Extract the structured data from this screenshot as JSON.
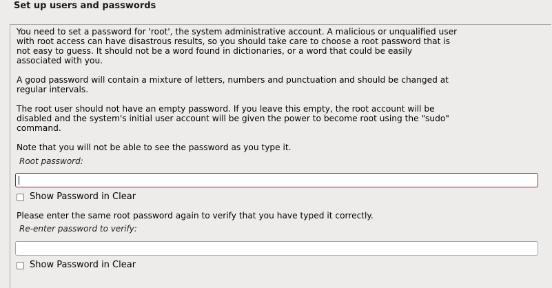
{
  "title": "Set up users and passwords",
  "paragraphs": {
    "intro": "You need to set a password for 'root', the system administrative account. A malicious or unqualified user\nwith root access can have disastrous results, so you should take care to choose a root password that is\nnot easy to guess. It should not be a word found in dictionaries, or a word that could be easily\nassociated with you.",
    "mixture": "A good password will contain a mixture of letters, numbers and punctuation and should be changed at\nregular intervals.",
    "empty": "The root user should not have an empty password. If you leave this empty, the root account will be\ndisabled and the system's initial user account will be given the power to become root using the \"sudo\"\ncommand.",
    "note": "Note that you will not be able to see the password as you type it.",
    "verify": "Please enter the same root password again to verify that you have typed it correctly."
  },
  "root_password": {
    "label": "Root password:",
    "value": "",
    "show_label": "Show Password in Clear"
  },
  "verify_password": {
    "label": "Re-enter password to verify:",
    "value": "",
    "show_label": "Show Password in Clear"
  },
  "colors": {
    "background": "#edeceb",
    "focus_border": "#98213f",
    "field_border": "#a6a6a6"
  }
}
